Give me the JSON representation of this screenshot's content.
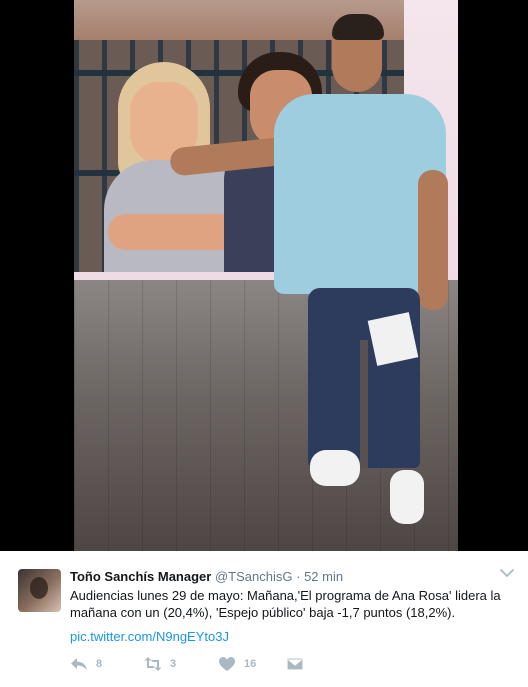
{
  "tweet": {
    "fullname": "Toño Sanchís Manager",
    "handle": "@TSanchisG",
    "separator": "·",
    "time": "52 min",
    "text": "Audiencias lunes 29 de mayo: Mañana,'El programa de Ana Rosa' lidera la mañana con un (20,4%), 'Espejo público' baja -1,7 puntos (18,2%).",
    "link": "pic.twitter.com/N9ngEYto3J",
    "actions": [
      {
        "name": "reply",
        "icon": "reply-icon",
        "count": "8"
      },
      {
        "name": "retweet",
        "icon": "retweet-icon",
        "count": "3"
      },
      {
        "name": "like",
        "icon": "heart-icon",
        "count": "16"
      },
      {
        "name": "message",
        "icon": "envelope-icon",
        "count": ""
      }
    ]
  },
  "colors": {
    "text": "#14171a",
    "meta": "#657786",
    "link": "#1b95e0",
    "action": "#aab8c2"
  }
}
